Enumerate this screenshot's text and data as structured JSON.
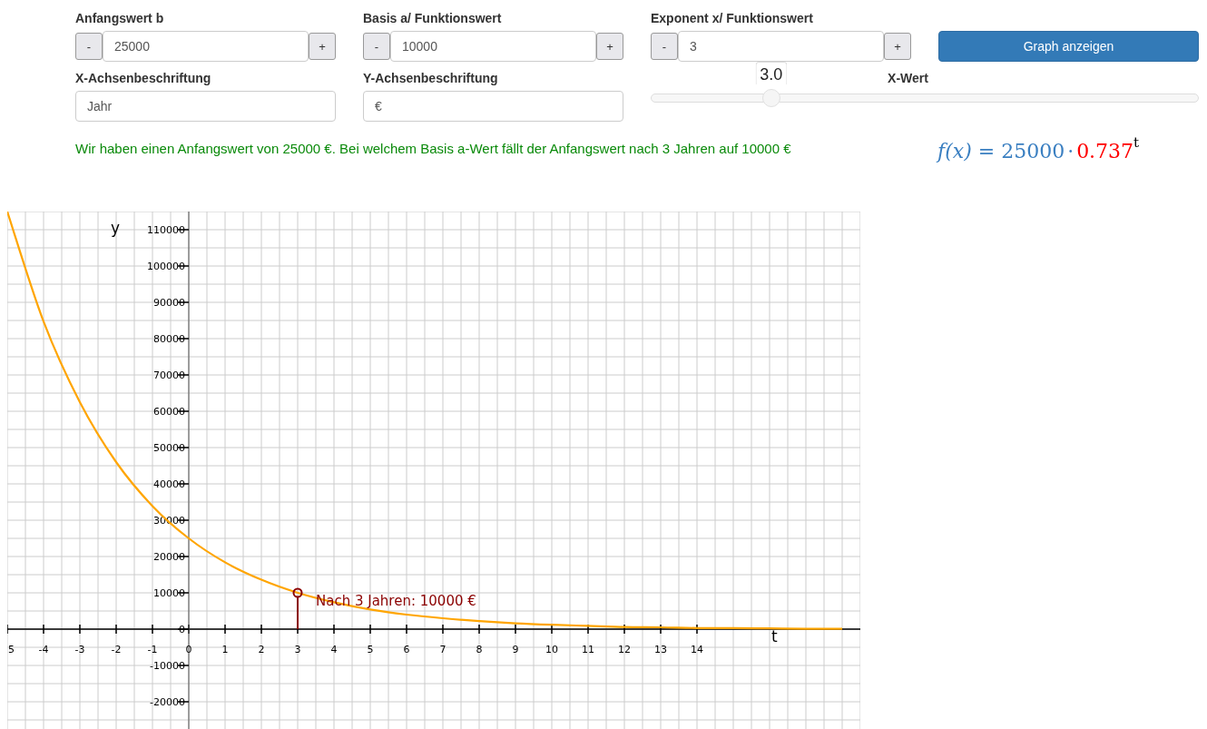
{
  "steppers": [
    {
      "label": "Anfangswert b",
      "minus": "-",
      "value": "25000",
      "plus": "+"
    },
    {
      "label": "Basis a/ Funktionswert",
      "minus": "-",
      "value": "10000",
      "plus": "+"
    },
    {
      "label": "Exponent x/ Funktionswert",
      "minus": "-",
      "value": "3",
      "plus": "+"
    }
  ],
  "show_button": "Graph anzeigen",
  "axis_fields": [
    {
      "label": "X-Achsenbeschriftung",
      "value": "Jahr"
    },
    {
      "label": "Y-Achsenbeschriftung",
      "value": "€"
    }
  ],
  "slider": {
    "label": "X-Wert",
    "reading": "3.0",
    "level": 0.22
  },
  "task_text": "Wir haben einen Anfangswert von 25000 €. Bei welchem Basis a-Wert fällt der Anfangswert nach 3 Jahren auf 10000 €",
  "formula": {
    "lhs": "f(x)",
    "equals": "=",
    "coefficient": "25000",
    "dot": "·",
    "base": "0.737",
    "exponent": "t"
  },
  "chart_data": {
    "type": "line",
    "xlabel": "t",
    "ylabel": "y",
    "xlim": [
      -5,
      18.5
    ],
    "ylim": [
      -27500,
      115000
    ],
    "xticks": [
      {
        "value": -5,
        "label": "5"
      },
      -4,
      -3,
      -2,
      -1,
      0,
      1,
      2,
      3,
      4,
      5,
      6,
      7,
      8,
      9,
      10,
      11,
      12,
      13,
      14
    ],
    "yticks": [
      -20000,
      -10000,
      0,
      10000,
      20000,
      30000,
      40000,
      50000,
      60000,
      70000,
      80000,
      90000,
      100000,
      110000
    ],
    "x": [
      -5,
      -4,
      -3,
      -2,
      -1,
      0,
      1,
      2,
      3,
      4,
      5,
      6,
      7,
      8,
      9,
      10,
      11,
      12,
      13,
      14,
      15,
      16,
      17,
      18
    ],
    "grid": true,
    "series": [
      {
        "color": "#ffa500",
        "values": [
          115000,
          84700,
          62500,
          46000,
          33900,
          25000,
          18400,
          13600,
          10000,
          7400,
          5400,
          4000,
          3000,
          2200,
          1600,
          1200,
          900,
          600,
          500,
          300,
          300,
          200,
          100,
          100
        ]
      }
    ],
    "annotations": [
      {
        "x": 3,
        "y": 10000,
        "text": "Nach 3 Jahren: 10000 €"
      }
    ]
  }
}
